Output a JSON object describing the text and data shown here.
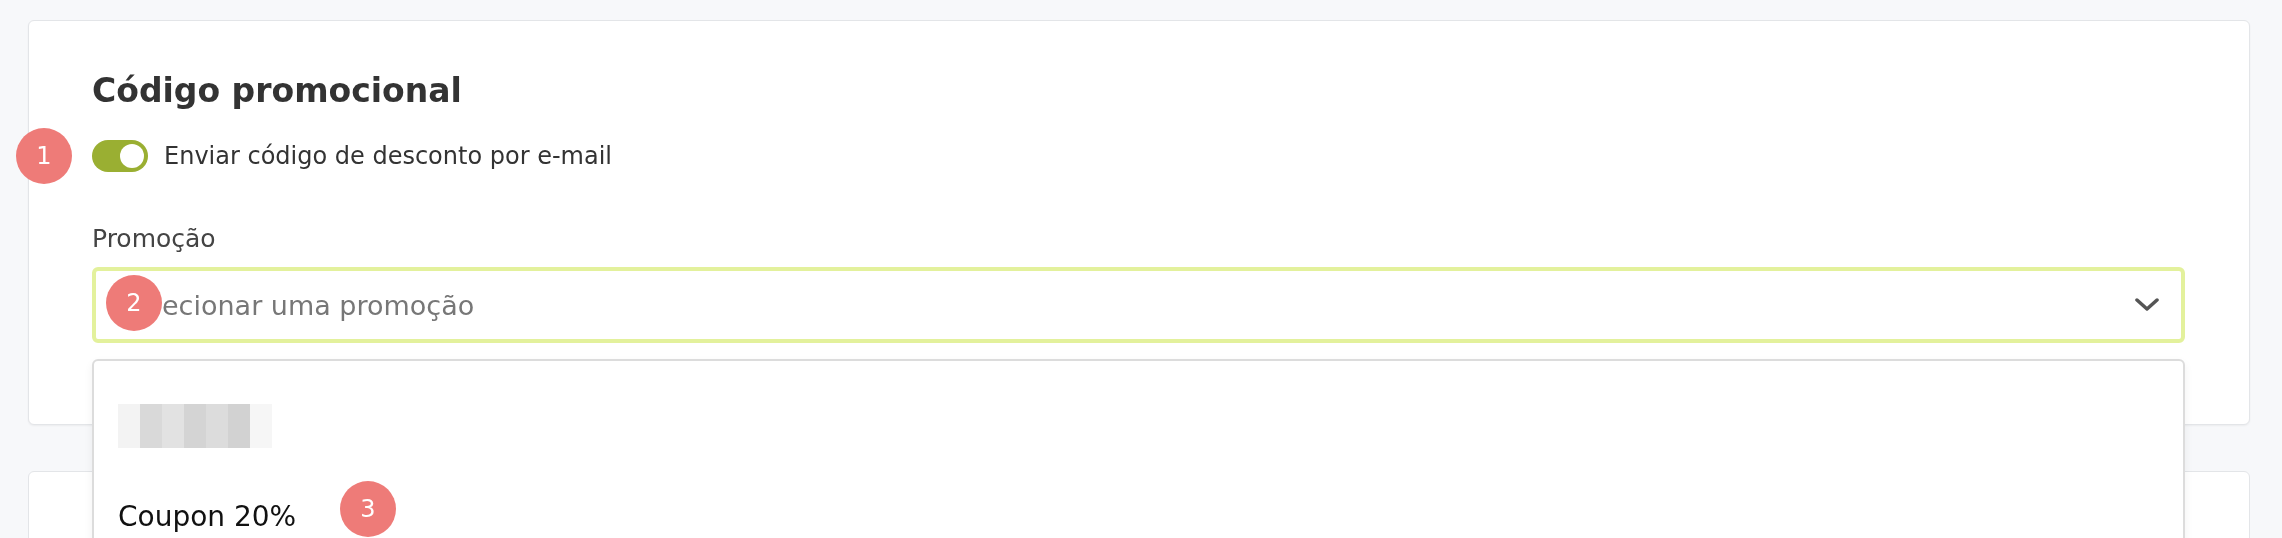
{
  "card": {
    "title": "Código promocional",
    "toggle": {
      "label": "Enviar código de desconto por e-mail",
      "on": true,
      "badge": "1"
    },
    "promotion": {
      "label": "Promoção",
      "placeholder": "ecionar uma promoção",
      "expanded": true,
      "badge": "2",
      "options": [
        {
          "kind": "redacted"
        },
        {
          "kind": "text",
          "label": "Coupon 20%",
          "badge": "3"
        }
      ]
    }
  }
}
